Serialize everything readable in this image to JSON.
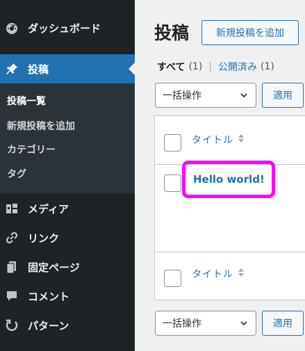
{
  "sidebar": {
    "items": [
      {
        "label": "ダッシュボード",
        "icon": "dashboard-icon"
      },
      {
        "label": "投稿",
        "icon": "pin-icon",
        "active": true
      },
      {
        "label": "メディア",
        "icon": "media-icon"
      },
      {
        "label": "リンク",
        "icon": "link-icon"
      },
      {
        "label": "固定ページ",
        "icon": "page-icon"
      },
      {
        "label": "コメント",
        "icon": "comment-icon"
      },
      {
        "label": "パターン",
        "icon": "pattern-icon"
      }
    ],
    "submenu": [
      {
        "label": "投稿一覧",
        "current": true
      },
      {
        "label": "新規投稿を追加"
      },
      {
        "label": "カテゴリー"
      },
      {
        "label": "タグ"
      }
    ]
  },
  "header": {
    "title": "投稿",
    "add_new_label": "新規投稿を追加"
  },
  "filters": {
    "all_label": "すべて",
    "all_count": "(1)",
    "separator": "|",
    "published_label": "公開済み",
    "published_count": "(1)"
  },
  "bulk_actions": {
    "top_selected": "一括操作",
    "top_apply": "適用",
    "bottom_selected": "一括操作",
    "bottom_apply": "適用"
  },
  "table": {
    "header_title": "タイトル",
    "footer_title": "タイトル",
    "rows": [
      {
        "title": "Hello world!"
      }
    ]
  },
  "colors": {
    "sidebar_bg": "#1d2327",
    "submenu_bg": "#2c3338",
    "accent": "#2271b1",
    "highlight": "#ff00ff"
  }
}
